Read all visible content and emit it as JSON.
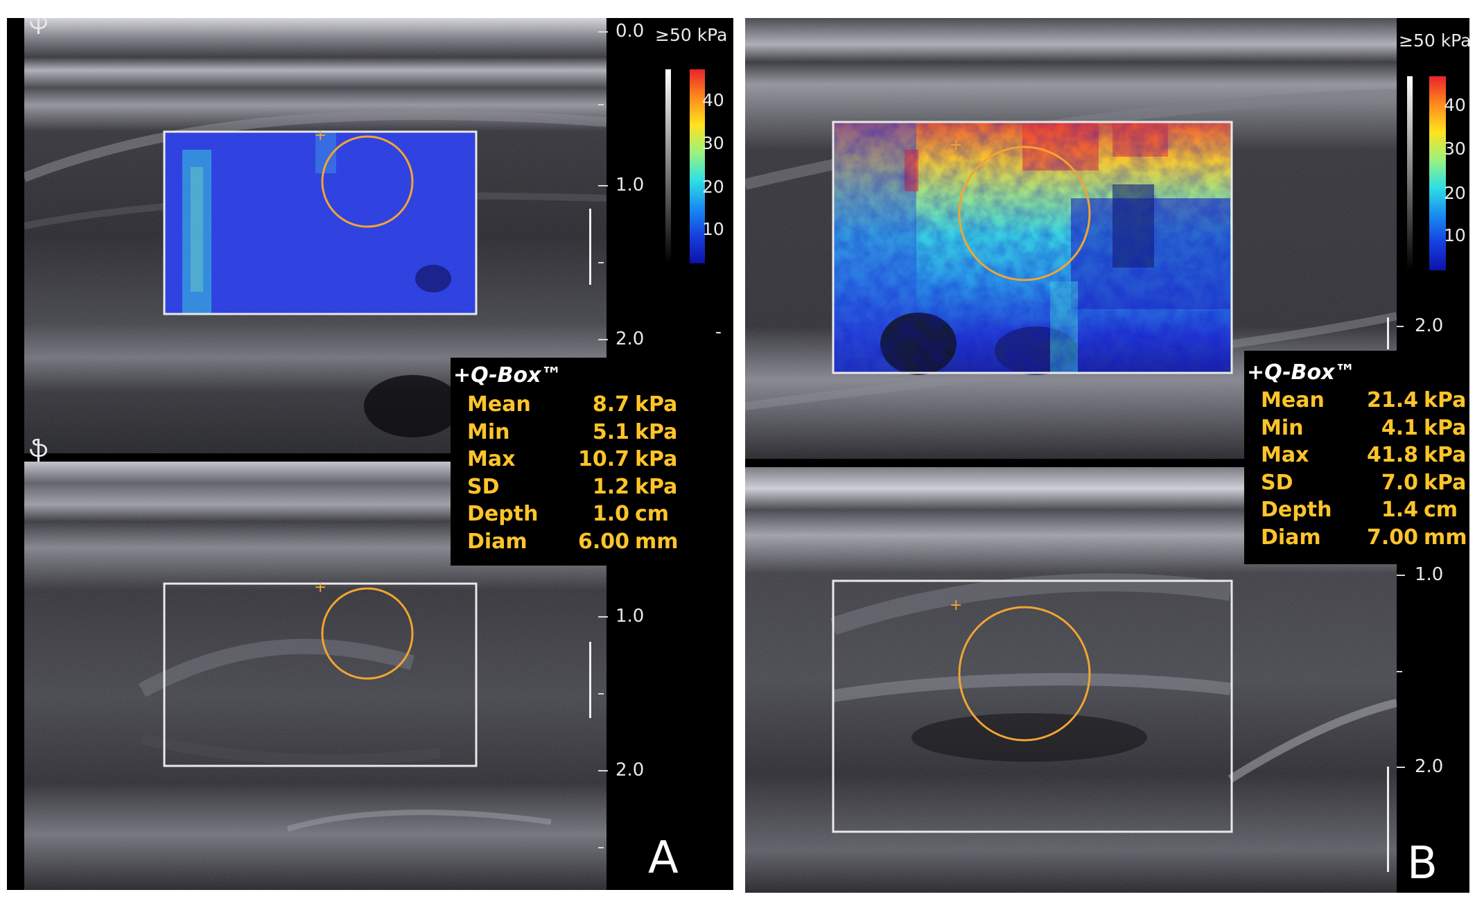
{
  "panels": [
    {
      "letter": "A",
      "orientation_mark": "ֆ",
      "depth_scale_top": [
        "0.0",
        "1.0",
        "2.0"
      ],
      "depth_scale_bottom": [
        "1.0",
        "2.0"
      ],
      "colorbar": {
        "max_label": "≥50 kPa",
        "ticks": [
          "40",
          "30",
          "20",
          "10"
        ],
        "min_mark": "-",
        "colors": [
          "#e8232a",
          "#ff8a1c",
          "#ffe21e",
          "#9cf27c",
          "#2ee0e3",
          "#1a8cf2",
          "#1640e0",
          "#0c12a8"
        ]
      },
      "qbox": {
        "title": "+Q-Box™",
        "rows": [
          {
            "label": "Mean",
            "value": "8.7",
            "unit": "kPa"
          },
          {
            "label": "Min",
            "value": "5.1",
            "unit": "kPa"
          },
          {
            "label": "Max",
            "value": "10.7",
            "unit": "kPa"
          },
          {
            "label": "SD",
            "value": "1.2",
            "unit": "kPa"
          },
          {
            "label": "Depth",
            "value": "1.0",
            "unit": "cm"
          },
          {
            "label": "Diam",
            "value": "6.00",
            "unit": "mm"
          }
        ]
      },
      "elastography_colors": [
        "#1d2fd6",
        "#2b3fe0",
        "#1a28b8",
        "#2fc7d8"
      ]
    },
    {
      "letter": "B",
      "depth_scale_top": [
        "2.0"
      ],
      "depth_scale_bottom": [
        "1.0",
        "2.0"
      ],
      "colorbar": {
        "max_label": "≥50 kPa",
        "ticks": [
          "40",
          "30",
          "20",
          "10"
        ],
        "colors": [
          "#e8232a",
          "#ff8a1c",
          "#ffe21e",
          "#9cf27c",
          "#2ee0e3",
          "#1a8cf2",
          "#1640e0",
          "#0c12a8"
        ]
      },
      "qbox": {
        "title": "+Q-Box™",
        "rows": [
          {
            "label": "Mean",
            "value": "21.4",
            "unit": "kPa"
          },
          {
            "label": "Min",
            "value": "4.1",
            "unit": "kPa"
          },
          {
            "label": "Max",
            "value": "41.8",
            "unit": "kPa"
          },
          {
            "label": "SD",
            "value": "7.0",
            "unit": "kPa"
          },
          {
            "label": "Depth",
            "value": "1.4",
            "unit": "cm"
          },
          {
            "label": "Diam",
            "value": "7.00",
            "unit": "mm"
          }
        ]
      }
    }
  ],
  "roi_colors": {
    "qbox_circle": "#f2a531",
    "roi_box": "#e9e9e9",
    "qbox_text": "#ffc42a"
  }
}
